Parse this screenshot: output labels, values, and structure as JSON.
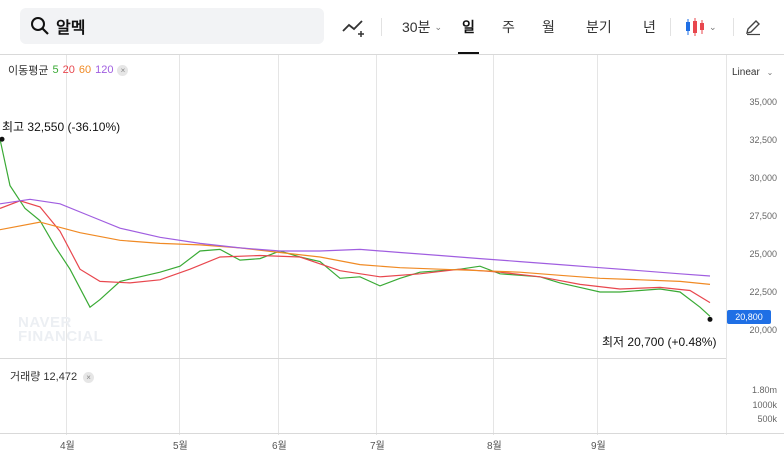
{
  "search": {
    "query": "알멕"
  },
  "toolbar": {
    "period_30m": "30분",
    "day": "일",
    "week": "주",
    "month": "월",
    "quarter": "분기",
    "year": "년"
  },
  "legend": {
    "title": "이동평균",
    "ma": [
      {
        "label": "5",
        "color": "#3aaa35"
      },
      {
        "label": "20",
        "color": "#e8474e"
      },
      {
        "label": "60",
        "color": "#f08a24"
      },
      {
        "label": "120",
        "color": "#a05ee0"
      }
    ]
  },
  "scale_mode": "Linear",
  "y_axis_ticks": [
    "35,000",
    "32,500",
    "30,000",
    "27,500",
    "25,000",
    "22,500",
    "20,000"
  ],
  "current_price": "20,800",
  "annotations": {
    "high": "최고  32,550 (-36.10%)",
    "low": "최저  20,700 (+0.48%)"
  },
  "watermark": [
    "NAVER",
    "FINANCIAL"
  ],
  "volume": {
    "label": "거래량 12,472",
    "ticks": [
      "1.80m",
      "1000k",
      "500k"
    ]
  },
  "x_axis_ticks": [
    "4월",
    "5월",
    "6월",
    "7월",
    "8월",
    "9월"
  ],
  "chart_data": {
    "type": "line",
    "title": "",
    "ylim": [
      20000,
      35000
    ],
    "series": [
      {
        "name": "5",
        "points": [
          [
            0,
            32550
          ],
          [
            10,
            29500
          ],
          [
            25,
            28000
          ],
          [
            40,
            27200
          ],
          [
            55,
            25500
          ],
          [
            70,
            24000
          ],
          [
            90,
            21500
          ],
          [
            100,
            22000
          ],
          [
            120,
            23200
          ],
          [
            140,
            23500
          ],
          [
            160,
            23800
          ],
          [
            180,
            24200
          ],
          [
            200,
            25200
          ],
          [
            220,
            25300
          ],
          [
            240,
            24600
          ],
          [
            260,
            24700
          ],
          [
            280,
            25200
          ],
          [
            300,
            24800
          ],
          [
            320,
            24500
          ],
          [
            340,
            23400
          ],
          [
            360,
            23500
          ],
          [
            380,
            22900
          ],
          [
            400,
            23400
          ],
          [
            420,
            23800
          ],
          [
            440,
            23900
          ],
          [
            460,
            24000
          ],
          [
            480,
            24200
          ],
          [
            500,
            23700
          ],
          [
            520,
            23600
          ],
          [
            540,
            23500
          ],
          [
            560,
            23100
          ],
          [
            580,
            22800
          ],
          [
            600,
            22500
          ],
          [
            620,
            22500
          ],
          [
            640,
            22600
          ],
          [
            660,
            22700
          ],
          [
            680,
            22500
          ],
          [
            700,
            21500
          ],
          [
            710,
            20900
          ]
        ]
      },
      {
        "name": "20",
        "points": [
          [
            0,
            28000
          ],
          [
            20,
            28500
          ],
          [
            40,
            28100
          ],
          [
            60,
            26500
          ],
          [
            80,
            24000
          ],
          [
            100,
            23200
          ],
          [
            130,
            23100
          ],
          [
            160,
            23300
          ],
          [
            190,
            24000
          ],
          [
            220,
            24800
          ],
          [
            260,
            24900
          ],
          [
            300,
            24800
          ],
          [
            340,
            23900
          ],
          [
            380,
            23500
          ],
          [
            420,
            23700
          ],
          [
            460,
            24000
          ],
          [
            500,
            23800
          ],
          [
            540,
            23500
          ],
          [
            580,
            23000
          ],
          [
            620,
            22700
          ],
          [
            660,
            22800
          ],
          [
            690,
            22600
          ],
          [
            710,
            21800
          ]
        ]
      },
      {
        "name": "60",
        "points": [
          [
            0,
            26600
          ],
          [
            40,
            27100
          ],
          [
            80,
            26400
          ],
          [
            120,
            25900
          ],
          [
            160,
            25700
          ],
          [
            200,
            25600
          ],
          [
            240,
            25400
          ],
          [
            280,
            25100
          ],
          [
            320,
            24800
          ],
          [
            360,
            24300
          ],
          [
            400,
            24100
          ],
          [
            440,
            24000
          ],
          [
            480,
            23900
          ],
          [
            520,
            23800
          ],
          [
            560,
            23600
          ],
          [
            600,
            23400
          ],
          [
            640,
            23300
          ],
          [
            680,
            23200
          ],
          [
            710,
            23000
          ]
        ]
      },
      {
        "name": "120",
        "points": [
          [
            0,
            28300
          ],
          [
            30,
            28600
          ],
          [
            60,
            28300
          ],
          [
            90,
            27500
          ],
          [
            120,
            26700
          ],
          [
            160,
            26100
          ],
          [
            200,
            25700
          ],
          [
            240,
            25400
          ],
          [
            280,
            25200
          ],
          [
            320,
            25200
          ],
          [
            360,
            25300
          ],
          [
            400,
            25100
          ],
          [
            440,
            24900
          ],
          [
            480,
            24700
          ],
          [
            520,
            24500
          ],
          [
            560,
            24300
          ],
          [
            600,
            24100
          ],
          [
            640,
            23900
          ],
          [
            680,
            23700
          ],
          [
            710,
            23550
          ]
        ]
      }
    ]
  }
}
